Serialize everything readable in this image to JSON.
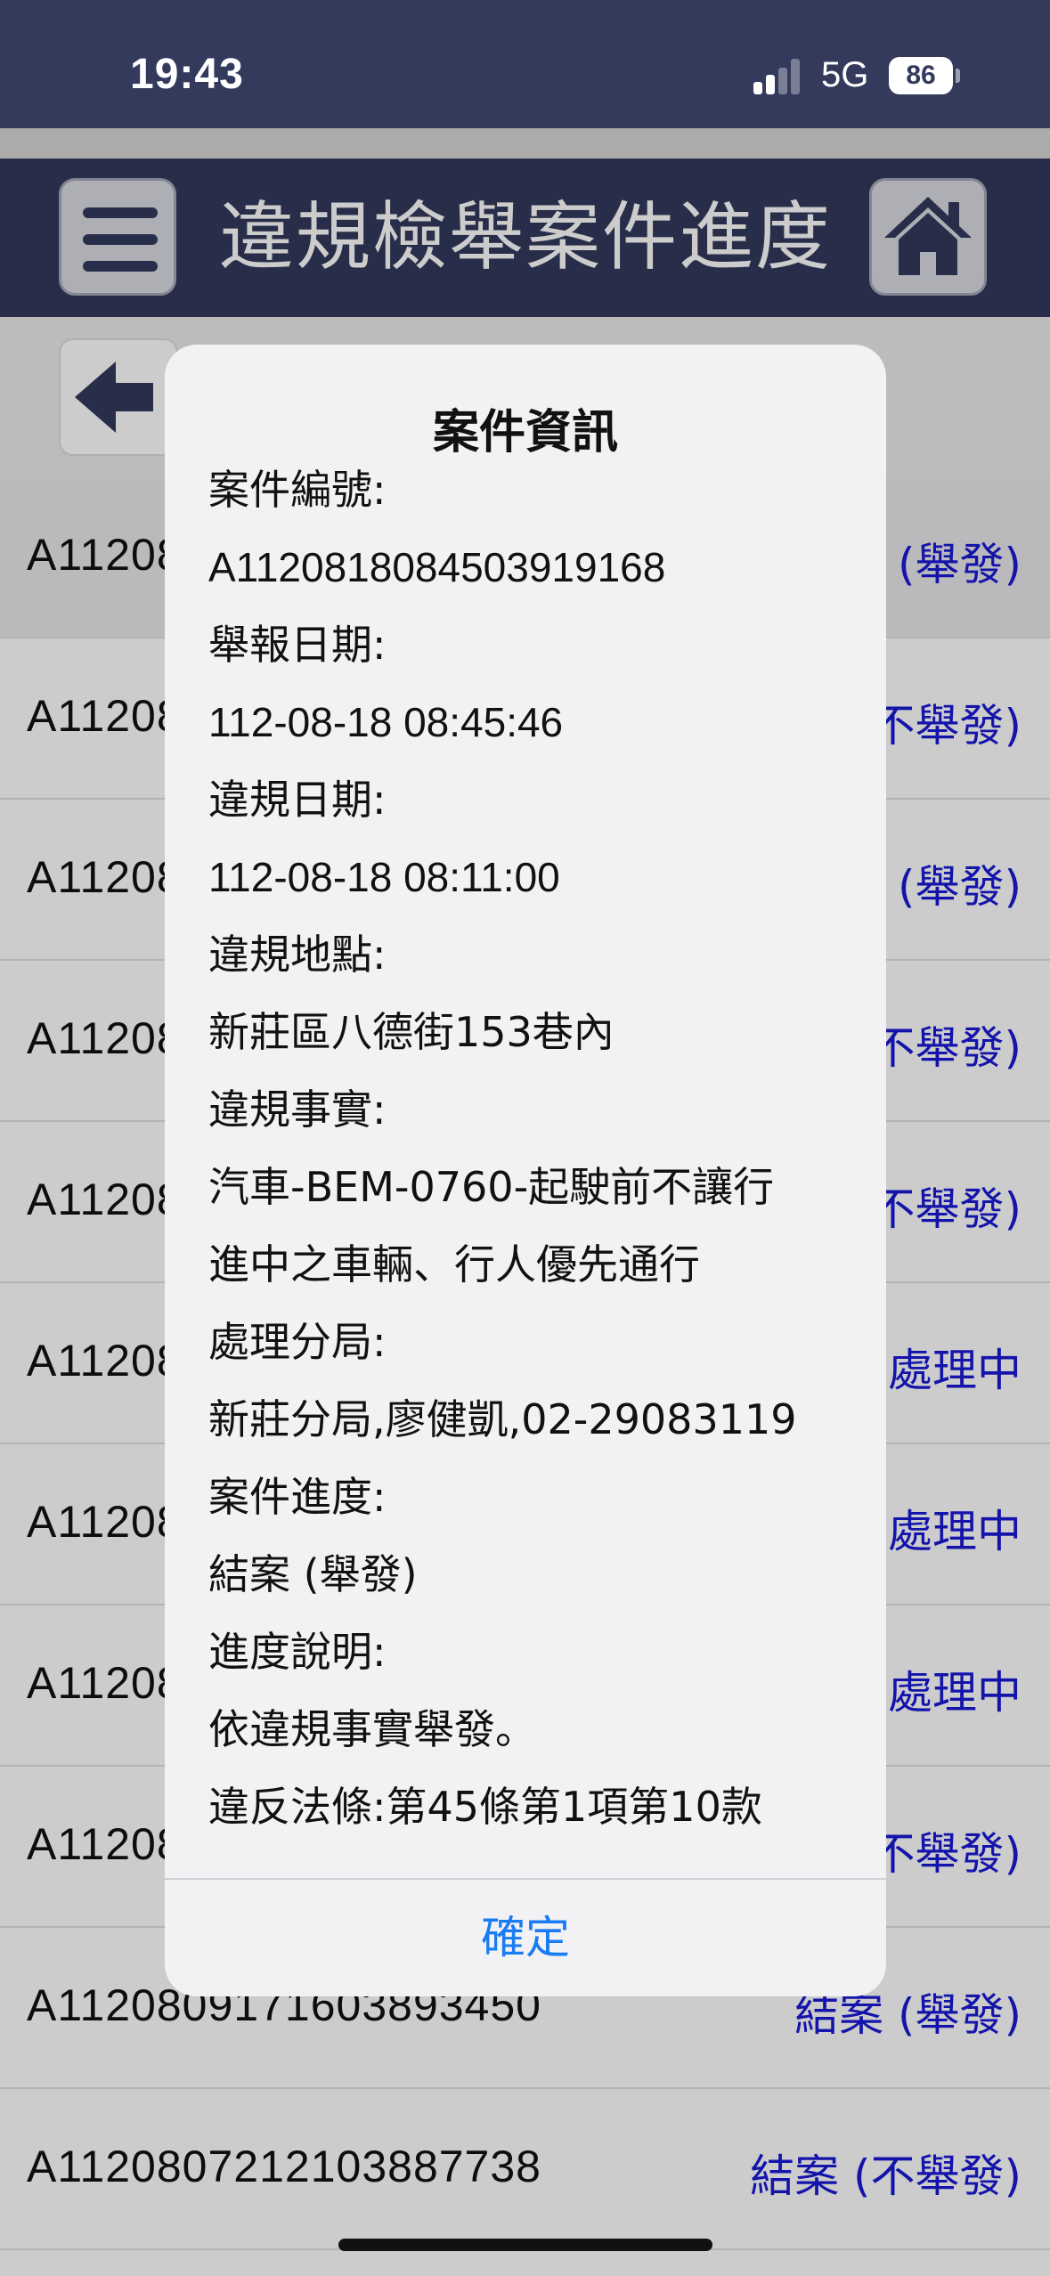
{
  "status_bar": {
    "time": "19:43",
    "network": "5G",
    "battery": "86"
  },
  "header": {
    "title": "違規檢舉案件進度"
  },
  "list": {
    "rows": [
      {
        "id": "A11208",
        "status": "(舉發)"
      },
      {
        "id": "A11208",
        "status": "不舉發)"
      },
      {
        "id": "A11208",
        "status": "(舉發)"
      },
      {
        "id": "A11208",
        "status": "不舉發)"
      },
      {
        "id": "A11208",
        "status": "不舉發)"
      },
      {
        "id": "A11208",
        "status": "處理中"
      },
      {
        "id": "A11208",
        "status": "處理中"
      },
      {
        "id": "A11208",
        "status": "處理中"
      },
      {
        "id": "A11208",
        "status": "不舉發)"
      },
      {
        "id": "A1120809171603893450",
        "status": "結案 (舉發)"
      },
      {
        "id": "A1120807212103887738",
        "status": "結案 (不舉發)"
      }
    ]
  },
  "dialog": {
    "title": "案件資訊",
    "lines": [
      "案件編號:",
      "A1120818084503919168",
      "舉報日期:",
      "112-08-18 08:45:46",
      "違規日期:",
      "112-08-18 08:11:00",
      "違規地點:",
      "新莊區八德街153巷內",
      "違規事實:",
      "汽車-BEM-0760-起駛前不讓行",
      "進中之車輛、行人優先通行",
      "處理分局:",
      "新莊分局,廖健凱,02-29083119",
      "案件進度:",
      "結案 (舉發)",
      "進度說明:",
      "依違規事實舉發。",
      "違反法條:第45條第1項第10款"
    ],
    "confirm_label": "確定"
  },
  "colors": {
    "header_bg": "#333a5c",
    "status_link": "#1a1ad6",
    "confirm": "#1a7cf2"
  }
}
